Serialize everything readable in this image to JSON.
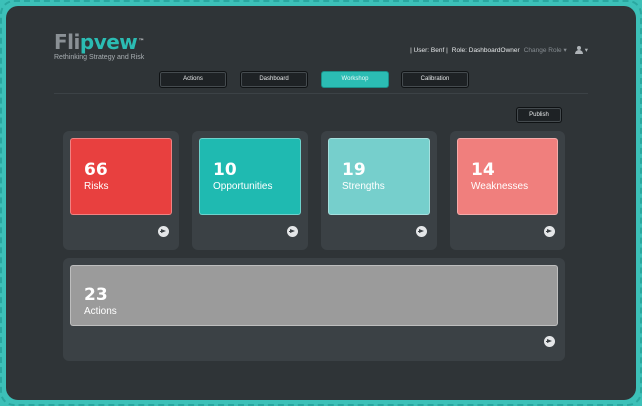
{
  "header": {
    "logo_prefix": "Fli",
    "logo_p": "p",
    "logo_suffix": "vew",
    "logo_tm": "™",
    "tagline": "Rethinking Strategy and Risk",
    "user_text": "| User: Benf |",
    "role_text": "Role: DashboardOwner",
    "change_role": "Change Role",
    "change_role_caret": "▾",
    "user_menu_caret": "▾"
  },
  "nav": {
    "actions": "Actions",
    "dashboard": "Dashboard",
    "workshop": "Workshop",
    "calibration": "Calibration"
  },
  "publish_label": "Publish",
  "cards": [
    {
      "count": "66",
      "label": "Risks",
      "color": "#e8403f"
    },
    {
      "count": "10",
      "label": "Opportunities",
      "color": "#1fbab1"
    },
    {
      "count": "19",
      "label": "Strengths",
      "color": "#76cfcc"
    },
    {
      "count": "14",
      "label": "Weaknesses",
      "color": "#f07f7d"
    }
  ],
  "actions_card": {
    "count": "23",
    "label": "Actions",
    "color": "#9b9b9b"
  },
  "colors": {
    "background": "#3cc0b8",
    "panel": "#2f3437",
    "accent": "#2bbcb3"
  }
}
